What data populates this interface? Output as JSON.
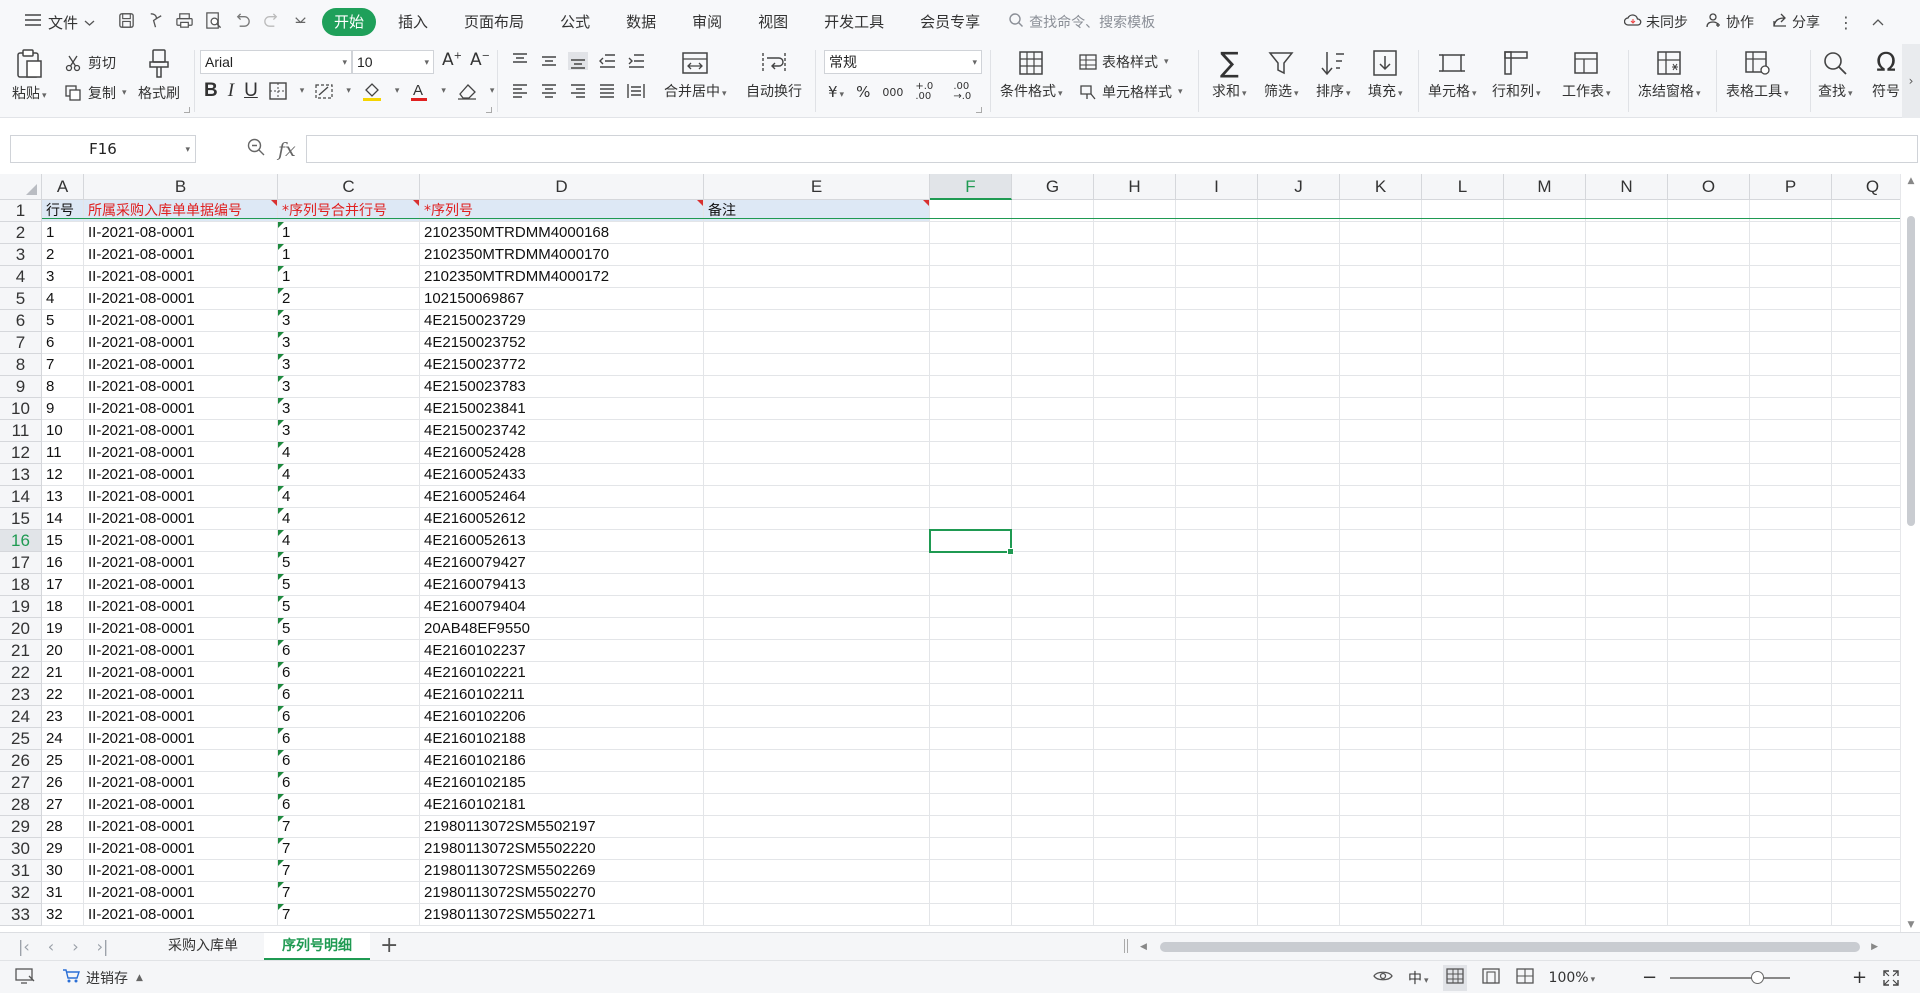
{
  "menubar": {
    "file_label": "文件",
    "tabs": [
      {
        "label": "开始",
        "active": true
      },
      {
        "label": "插入"
      },
      {
        "label": "页面布局"
      },
      {
        "label": "公式"
      },
      {
        "label": "数据"
      },
      {
        "label": "审阅"
      },
      {
        "label": "视图"
      },
      {
        "label": "开发工具"
      },
      {
        "label": "会员专享"
      }
    ],
    "search_placeholder": "查找命令、搜索模板",
    "sync_label": "未同步",
    "collab_label": "协作",
    "share_label": "分享"
  },
  "ribbon": {
    "paste": "粘贴",
    "cut": "剪切",
    "copy": "复制",
    "format_painter": "格式刷",
    "font_name": "Arial",
    "font_size": "10",
    "bold": "B",
    "italic": "I",
    "underline": "U",
    "merge_center": "合并居中",
    "wrap_text": "自动换行",
    "number_format": "常规",
    "currency": "¥",
    "percent": "%",
    "thousands": "000",
    "inc_decimal": "+.0 .00",
    "dec_decimal": ".00 →.0",
    "cond_format": "条件格式",
    "table_style": "表格样式",
    "cell_style": "单元格样式",
    "sum": "求和",
    "filter": "筛选",
    "sort": "排序",
    "fill": "填充",
    "cell": "单元格",
    "row_col": "行和列",
    "worksheet": "工作表",
    "freeze": "冻结窗格",
    "table_tools": "表格工具",
    "find": "查找",
    "symbol": "符号"
  },
  "formula_bar": {
    "name_box": "F16",
    "fx": "fx",
    "formula": ""
  },
  "columns": [
    "A",
    "B",
    "C",
    "D",
    "E",
    "F",
    "G",
    "H",
    "I",
    "J",
    "K",
    "L",
    "M",
    "N",
    "O",
    "P",
    "Q"
  ],
  "selected_col": "F",
  "selected_row": 16,
  "headers": {
    "A": "行号",
    "B": "所属采购入库单单据编号",
    "C": "*序列号合并行号",
    "D": "*序列号",
    "E": "备注"
  },
  "rows": [
    {
      "a": "1",
      "b": "II-2021-08-0001",
      "c": "1",
      "d": "2102350MTRDMM4000168"
    },
    {
      "a": "2",
      "b": "II-2021-08-0001",
      "c": "1",
      "d": "2102350MTRDMM4000170"
    },
    {
      "a": "3",
      "b": "II-2021-08-0001",
      "c": "1",
      "d": "2102350MTRDMM4000172"
    },
    {
      "a": "4",
      "b": "II-2021-08-0001",
      "c": "2",
      "d": "102150069867"
    },
    {
      "a": "5",
      "b": "II-2021-08-0001",
      "c": "3",
      "d": "4E2150023729"
    },
    {
      "a": "6",
      "b": "II-2021-08-0001",
      "c": "3",
      "d": "4E2150023752"
    },
    {
      "a": "7",
      "b": "II-2021-08-0001",
      "c": "3",
      "d": "4E2150023772"
    },
    {
      "a": "8",
      "b": "II-2021-08-0001",
      "c": "3",
      "d": "4E2150023783"
    },
    {
      "a": "9",
      "b": "II-2021-08-0001",
      "c": "3",
      "d": "4E2150023841"
    },
    {
      "a": "10",
      "b": "II-2021-08-0001",
      "c": "3",
      "d": "4E2150023742"
    },
    {
      "a": "11",
      "b": "II-2021-08-0001",
      "c": "4",
      "d": "4E2160052428"
    },
    {
      "a": "12",
      "b": "II-2021-08-0001",
      "c": "4",
      "d": "4E2160052433"
    },
    {
      "a": "13",
      "b": "II-2021-08-0001",
      "c": "4",
      "d": "4E2160052464"
    },
    {
      "a": "14",
      "b": "II-2021-08-0001",
      "c": "4",
      "d": "4E2160052612"
    },
    {
      "a": "15",
      "b": "II-2021-08-0001",
      "c": "4",
      "d": "4E2160052613"
    },
    {
      "a": "16",
      "b": "II-2021-08-0001",
      "c": "5",
      "d": "4E2160079427"
    },
    {
      "a": "17",
      "b": "II-2021-08-0001",
      "c": "5",
      "d": "4E2160079413"
    },
    {
      "a": "18",
      "b": "II-2021-08-0001",
      "c": "5",
      "d": "4E2160079404"
    },
    {
      "a": "19",
      "b": "II-2021-08-0001",
      "c": "5",
      "d": "20AB48EF9550"
    },
    {
      "a": "20",
      "b": "II-2021-08-0001",
      "c": "6",
      "d": "4E2160102237"
    },
    {
      "a": "21",
      "b": "II-2021-08-0001",
      "c": "6",
      "d": "4E2160102221"
    },
    {
      "a": "22",
      "b": "II-2021-08-0001",
      "c": "6",
      "d": "4E2160102211"
    },
    {
      "a": "23",
      "b": "II-2021-08-0001",
      "c": "6",
      "d": "4E2160102206"
    },
    {
      "a": "24",
      "b": "II-2021-08-0001",
      "c": "6",
      "d": "4E2160102188"
    },
    {
      "a": "25",
      "b": "II-2021-08-0001",
      "c": "6",
      "d": "4E2160102186"
    },
    {
      "a": "26",
      "b": "II-2021-08-0001",
      "c": "6",
      "d": "4E2160102185"
    },
    {
      "a": "27",
      "b": "II-2021-08-0001",
      "c": "6",
      "d": "4E2160102181"
    },
    {
      "a": "28",
      "b": "II-2021-08-0001",
      "c": "7",
      "d": "21980113072SM5502197"
    },
    {
      "a": "29",
      "b": "II-2021-08-0001",
      "c": "7",
      "d": "21980113072SM5502220"
    },
    {
      "a": "30",
      "b": "II-2021-08-0001",
      "c": "7",
      "d": "21980113072SM5502269"
    },
    {
      "a": "31",
      "b": "II-2021-08-0001",
      "c": "7",
      "d": "21980113072SM5502270"
    },
    {
      "a": "32",
      "b": "II-2021-08-0001",
      "c": "7",
      "d": "21980113072SM5502271"
    }
  ],
  "sheets": [
    {
      "label": "采购入库单",
      "active": false
    },
    {
      "label": "序列号明细",
      "active": true
    }
  ],
  "status": {
    "macro_label": "进销存",
    "input_mode": "中",
    "zoom": "100%",
    "zoom_minus": "−",
    "zoom_plus": "+"
  },
  "colors": {
    "accent": "#1fa05a",
    "header_fill": "#dde8f5",
    "required_red": "#e02020"
  }
}
